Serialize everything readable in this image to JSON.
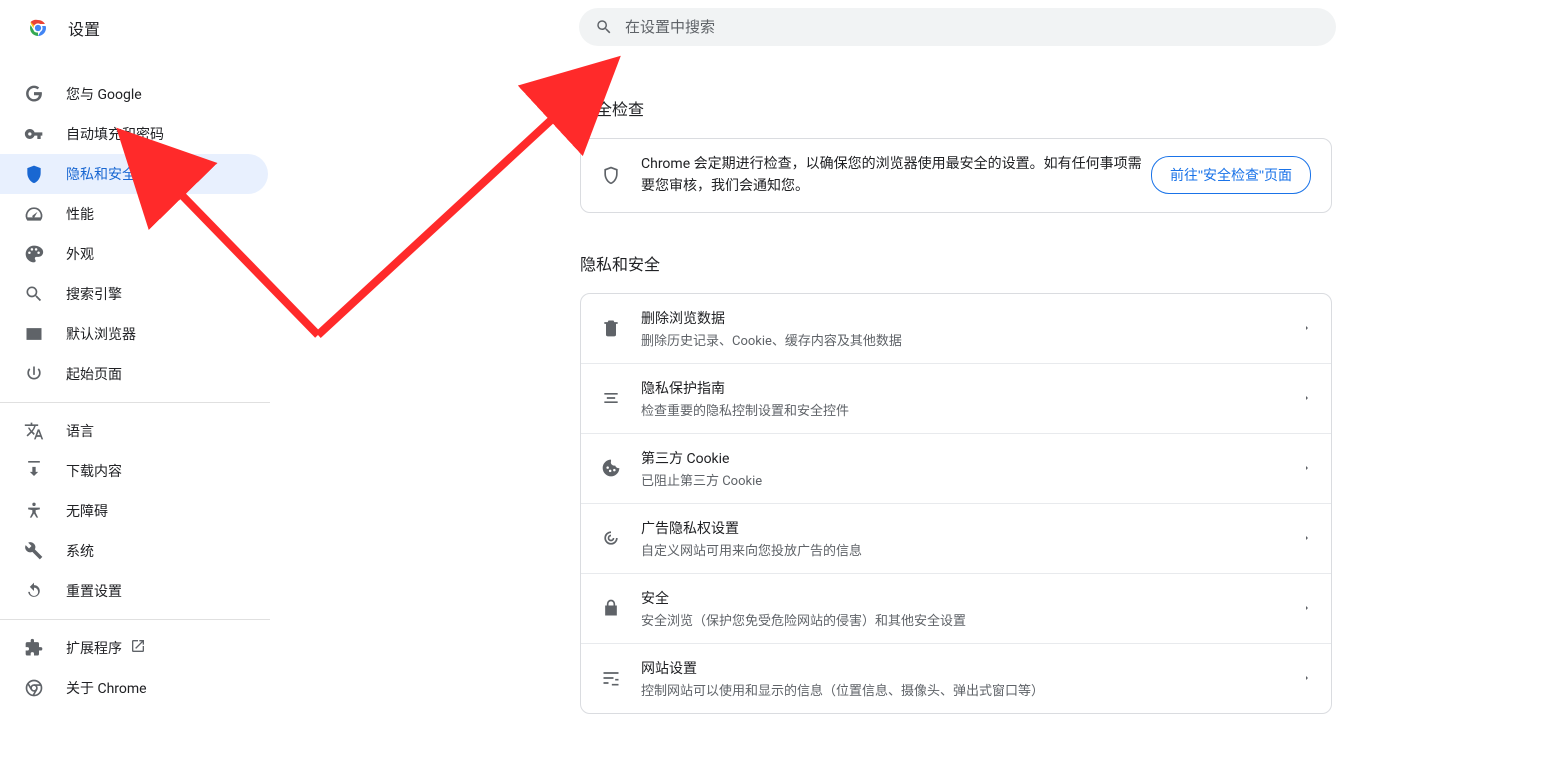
{
  "header": {
    "title": "设置"
  },
  "search": {
    "placeholder": "在设置中搜索"
  },
  "sidebar": {
    "group1": [
      {
        "label": "您与 Google"
      },
      {
        "label": "自动填充和密码"
      },
      {
        "label": "隐私和安全"
      },
      {
        "label": "性能"
      },
      {
        "label": "外观"
      },
      {
        "label": "搜索引擎"
      },
      {
        "label": "默认浏览器"
      },
      {
        "label": "起始页面"
      }
    ],
    "group2": [
      {
        "label": "语言"
      },
      {
        "label": "下载内容"
      },
      {
        "label": "无障碍"
      },
      {
        "label": "系统"
      },
      {
        "label": "重置设置"
      }
    ],
    "group3": [
      {
        "label": "扩展程序"
      },
      {
        "label": "关于 Chrome"
      }
    ]
  },
  "main": {
    "safety": {
      "title": "安全检查",
      "text": "Chrome 会定期进行检查，以确保您的浏览器使用最安全的设置。如有任何事项需要您审核，我们会通知您。",
      "button": "前往\"安全检查\"页面"
    },
    "privacy": {
      "title": "隐私和安全",
      "rows": [
        {
          "title": "删除浏览数据",
          "sub": "删除历史记录、Cookie、缓存内容及其他数据"
        },
        {
          "title": "隐私保护指南",
          "sub": "检查重要的隐私控制设置和安全控件"
        },
        {
          "title": "第三方 Cookie",
          "sub": "已阻止第三方 Cookie"
        },
        {
          "title": "广告隐私权设置",
          "sub": "自定义网站可用来向您投放广告的信息"
        },
        {
          "title": "安全",
          "sub": "安全浏览（保护您免受危险网站的侵害）和其他安全设置"
        },
        {
          "title": "网站设置",
          "sub": "控制网站可以使用和显示的信息（位置信息、摄像头、弹出式窗口等）"
        }
      ]
    }
  }
}
